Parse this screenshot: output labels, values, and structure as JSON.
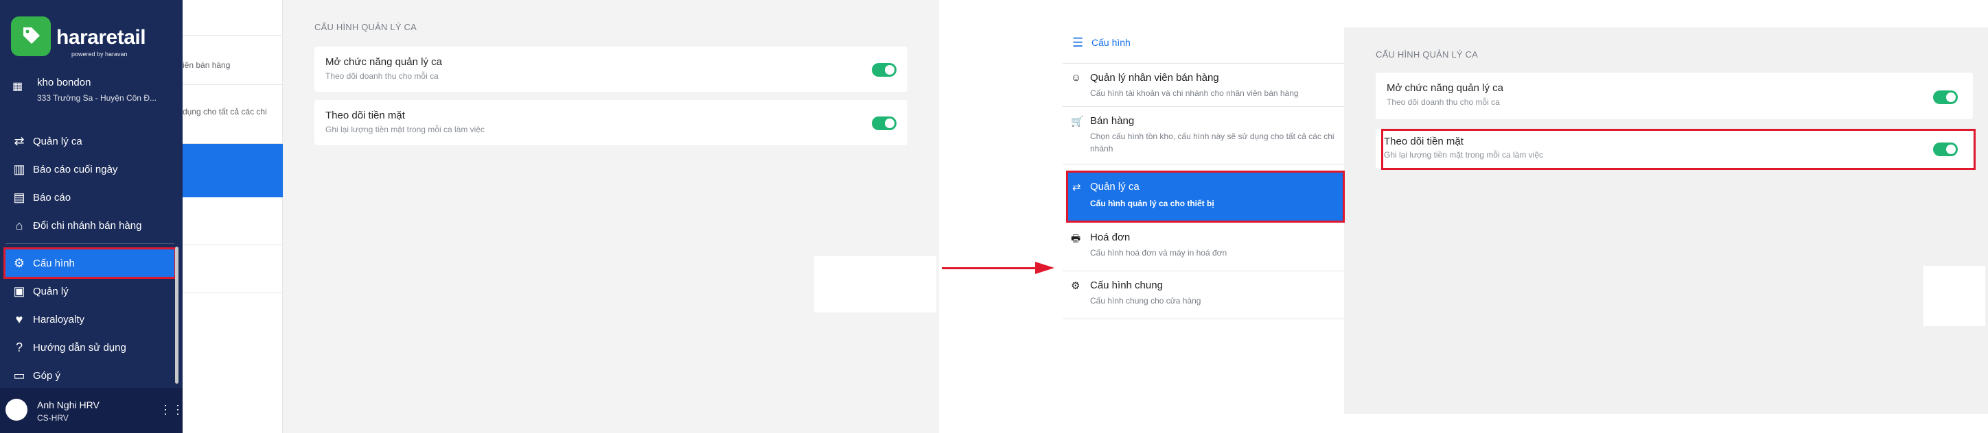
{
  "colors": {
    "sidebar_bg": "#1a2b59",
    "accent": "#1a73e8",
    "toggle_on": "#21b573",
    "highlight": "#e0182d",
    "logo_green": "#35b34a"
  },
  "left": {
    "brand": {
      "name": "hararetail",
      "sub": "powered by haravan"
    },
    "store": {
      "icon": "store-icon",
      "name": "kho bondon",
      "address": "333 Trường Sa - Huyện Côn Đ..."
    },
    "nav": [
      {
        "icon": "swap-icon",
        "label": "Quản lý ca",
        "active": false
      },
      {
        "icon": "chart-icon",
        "label": "Báo cáo cuối ngày",
        "active": false
      },
      {
        "icon": "report-icon",
        "label": "Báo cáo",
        "active": false
      },
      {
        "icon": "shop-icon",
        "label": "Đổi chi nhánh bán hàng",
        "active": false
      },
      {
        "icon": "gear-icon",
        "label": "Cấu hình",
        "active": true
      },
      {
        "icon": "clipboard-icon",
        "label": "Quản lý",
        "active": false
      },
      {
        "icon": "heart-icon",
        "label": "Haraloyalty",
        "active": false
      },
      {
        "icon": "help-icon",
        "label": "Hướng dẫn sử dụng",
        "active": false
      },
      {
        "icon": "feedback-icon",
        "label": "Góp ý",
        "active": false
      }
    ],
    "user": {
      "name": "Anh Nghi HRV",
      "role": "CS-HRV"
    },
    "under_list": {
      "row1": "iên bán hàng",
      "row2": "dụng cho tất cả các chi"
    },
    "section_title": "CẤU HÌNH QUẢN LÝ CA",
    "cards": [
      {
        "title": "Mở chức năng quản lý ca",
        "desc": "Theo dõi doanh thu cho mỗi ca",
        "toggle_on": true
      },
      {
        "title": "Theo dõi tiền mặt",
        "desc": "Ghi lại lượng tiền mặt trong mỗi ca làm việc",
        "toggle_on": true
      }
    ]
  },
  "right": {
    "header": {
      "icon": "menu-icon",
      "label": "Cấu hình"
    },
    "items": [
      {
        "icon": "face-icon",
        "title": "Quản lý nhân viên bán hàng",
        "desc": "Cấu hình tài khoản và chi nhánh cho nhân viên bán hàng",
        "active": false
      },
      {
        "icon": "cart-icon",
        "title": "Bán hàng",
        "desc": "Chọn cấu hình tồn kho, cấu hình này sẽ sử dụng cho tất cả các chi nhánh",
        "active": false
      },
      {
        "icon": "swap-icon",
        "title": "Quản lý ca",
        "desc": "Cấu hình quản lý ca cho thiết bị",
        "active": true
      },
      {
        "icon": "printer-icon",
        "title": "Hoá đơn",
        "desc": "Cấu hình hoá đơn và máy in hoá đơn",
        "active": false
      },
      {
        "icon": "gear-icon",
        "title": "Cấu hình chung",
        "desc": "Cấu hình chung cho cửa hàng",
        "active": false
      }
    ],
    "section_title": "CẤU HÌNH QUẢN LÝ CA",
    "cards": [
      {
        "title": "Mở chức năng quản lý ca",
        "desc": "Theo dõi doanh thu cho mỗi ca",
        "toggle_on": true
      },
      {
        "title": "Theo dõi tiền mặt",
        "desc": "Ghi lại lượng tiền mặt trong mỗi ca làm việc",
        "toggle_on": true
      }
    ]
  }
}
